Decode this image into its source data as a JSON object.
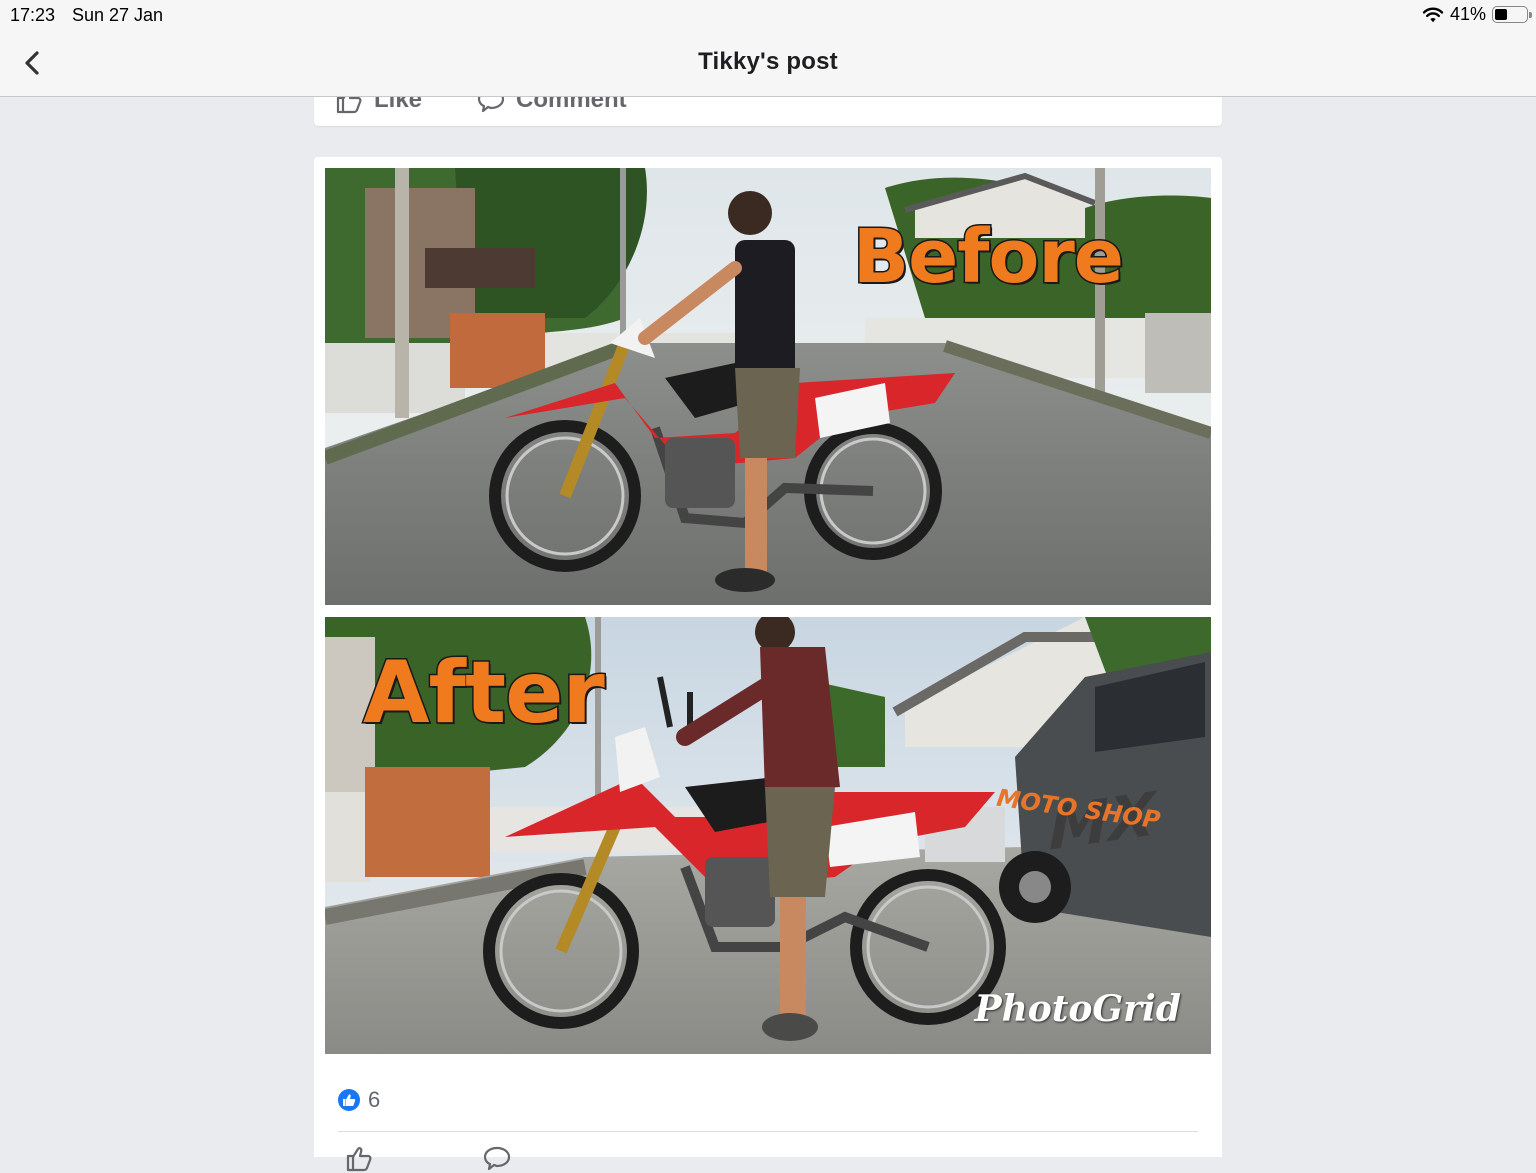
{
  "status_bar": {
    "time": "17:23",
    "date": "Sun 27 Jan",
    "battery_percent": "41%",
    "battery_level": 0.41
  },
  "nav": {
    "title": "Tikky's post",
    "back_icon": "chevron-left-icon"
  },
  "post_actions": {
    "like_label": "Like",
    "comment_label": "Comment"
  },
  "photos": {
    "before_label": "Before",
    "after_label": "After",
    "watermark": "PhotoGrid",
    "truck_logo": "MX",
    "truck_logo_sub": "MOTO SHOP"
  },
  "reactions": {
    "icon": "thumbs-up-icon",
    "count": "6"
  },
  "colors": {
    "background": "#e9ebee",
    "accent": "#1877f2",
    "label_orange": "#f07a1e",
    "bike_red": "#d8262b"
  }
}
